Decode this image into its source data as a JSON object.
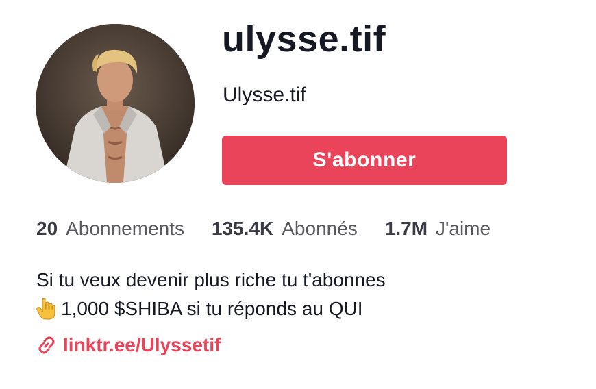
{
  "profile": {
    "username": "ulysse.tif",
    "display_name": "Ulysse.tif",
    "avatar_icon": "profile-photo"
  },
  "actions": {
    "follow_label": "S'abonner"
  },
  "stats": [
    {
      "value": "20",
      "label": "Abonnements"
    },
    {
      "value": "135.4K",
      "label": "Abonnés"
    },
    {
      "value": "1.7M",
      "label": "J'aime"
    }
  ],
  "bio": {
    "line1": "Si tu veux devenir plus riche tu t'abonnes",
    "line2_icon": "pointing-down-hand-emoji",
    "line2": "1,000 $SHIBA si tu réponds au QUI"
  },
  "link": {
    "icon": "link-icon",
    "text": "linktr.ee/Ulyssetif"
  },
  "colors": {
    "accent": "#ea445a",
    "link": "#e8455a",
    "text_primary": "#161823",
    "text_secondary": "#58595f"
  }
}
